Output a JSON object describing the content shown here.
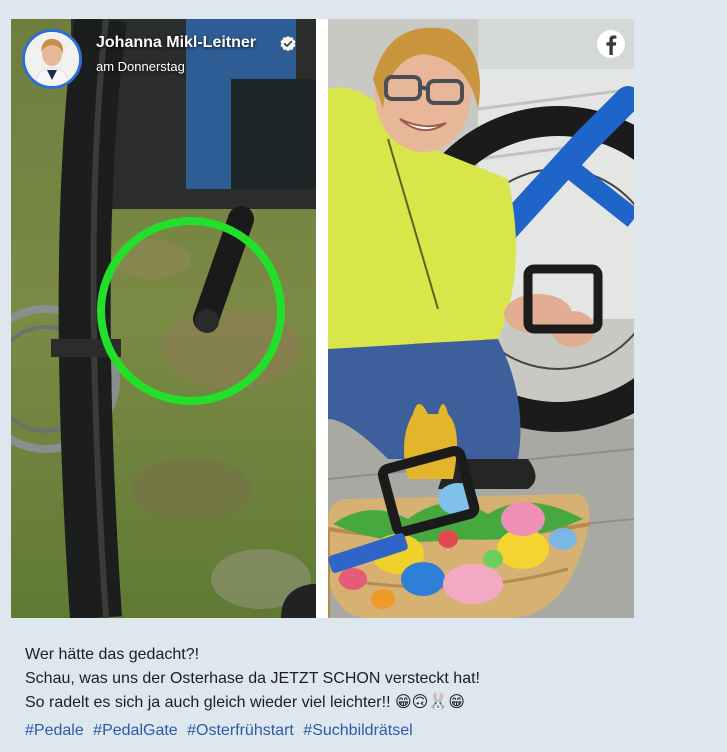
{
  "author": {
    "name": "Johanna Mikl-Leitner",
    "time": "am Donnerstag",
    "verified": true,
    "verified_icon": "verified-check-icon",
    "avatar_icon": "profile-photo"
  },
  "network_icon": "facebook-icon",
  "colors": {
    "background": "#dfe7ee",
    "link": "#2e5aa7",
    "avatar_ring": "#2d6fd6",
    "highlight_circle": "#22e02a"
  },
  "post": {
    "lines": [
      "Wer hätte das gedacht?!",
      "Schau, was uns der Osterhase da JETZT SCHON versteckt hat!",
      "So radelt es sich ja auch gleich wieder viel leichter!! 😁🙃🐰😁"
    ],
    "hashtags": [
      "#Pedale",
      "#PedalGate",
      "#Osterfrühstart",
      "#Suchbildrätsel"
    ]
  }
}
